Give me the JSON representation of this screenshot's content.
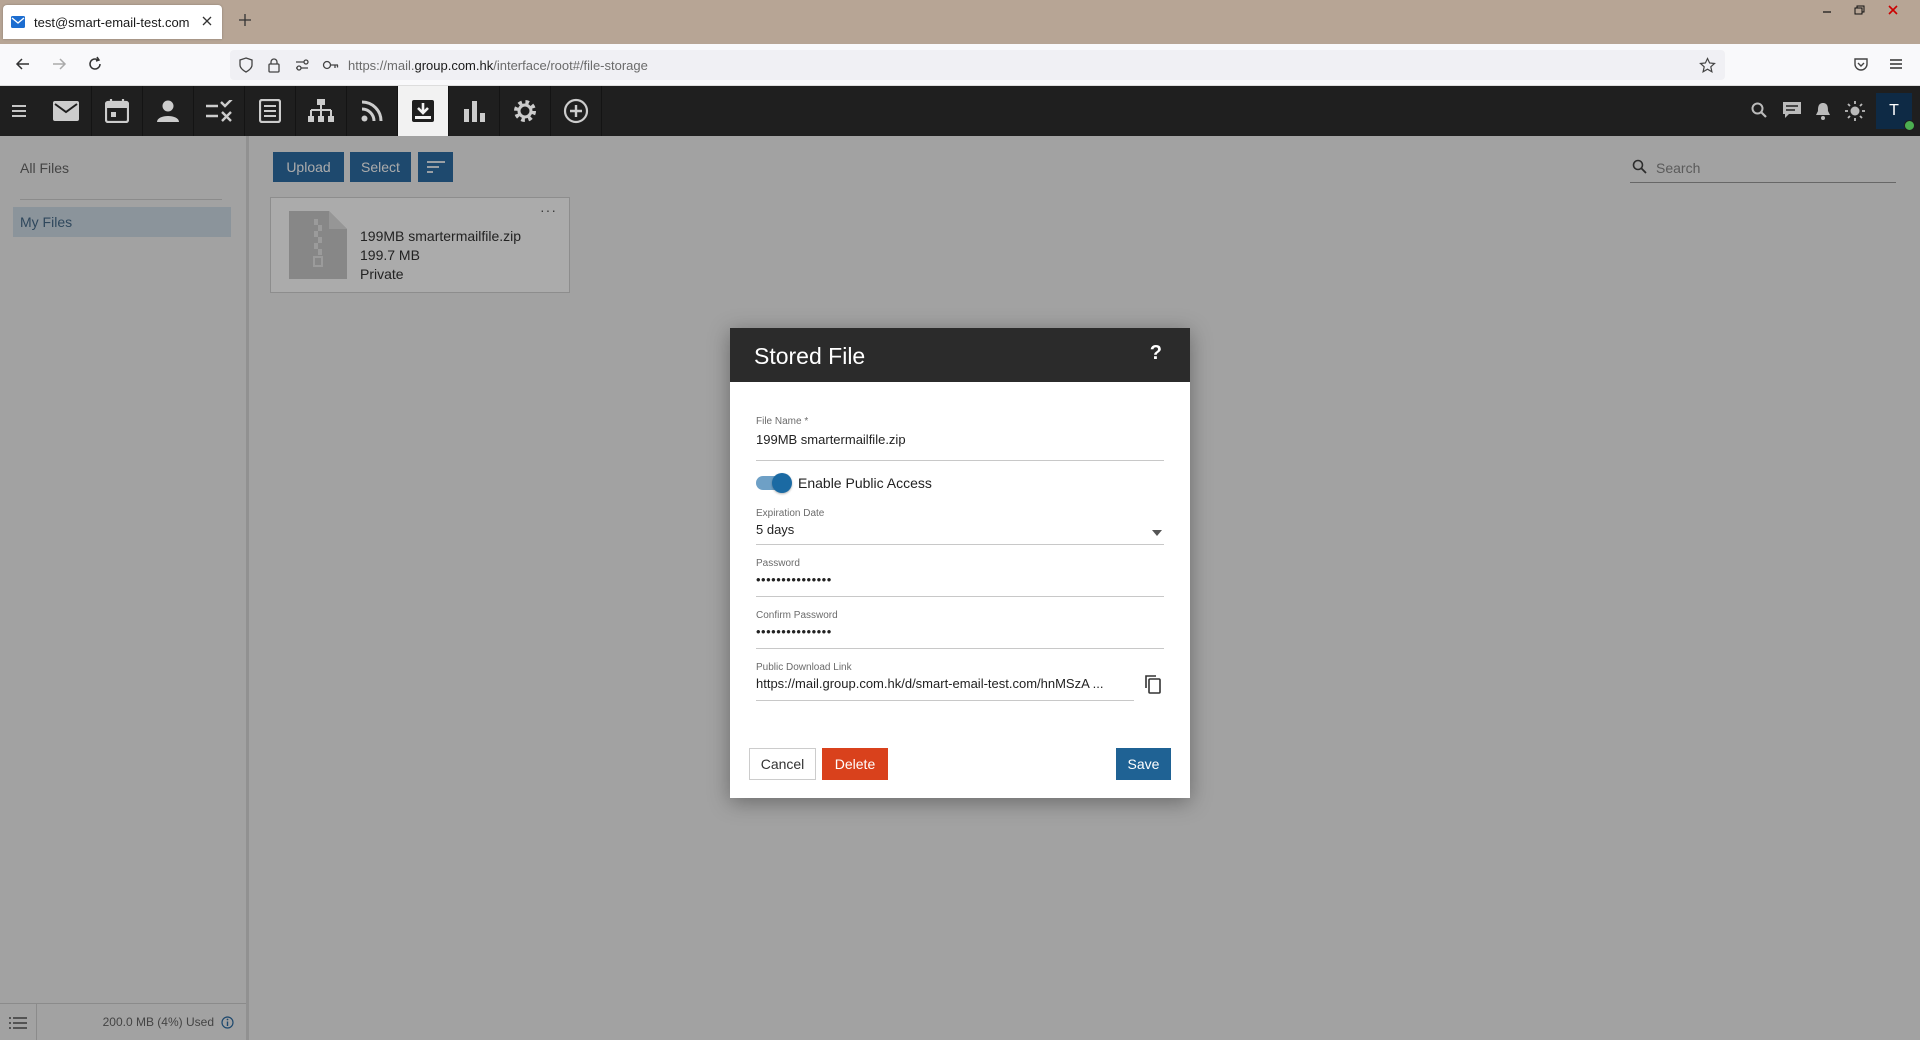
{
  "browser": {
    "tab_title": "test@smart-email-test.com",
    "url_prefix": "https://mail.",
    "url_domain": "group.com.hk",
    "url_path": "/interface/root#/file-storage"
  },
  "toolbar": {
    "icons": [
      "menu-icon",
      "mail-icon",
      "calendar-icon",
      "contacts-icon",
      "tasks-icon",
      "notes-icon",
      "sitemap-icon",
      "rss-icon",
      "file-storage-icon",
      "reports-icon",
      "settings-icon",
      "add-icon"
    ],
    "avatar_letter": "T",
    "avatar_color": "#0e2a45"
  },
  "sidebar": {
    "all_files": "All Files",
    "my_files": "My Files",
    "usage": "200.0 MB (4%) Used"
  },
  "content": {
    "upload_label": "Upload",
    "select_label": "Select",
    "search_placeholder": "Search",
    "file": {
      "name": "199MB smartermailfile.zip",
      "size": "199.7 MB",
      "access": "Private",
      "more": "···"
    }
  },
  "modal": {
    "title": "Stored File",
    "help": "?",
    "file_name_label": "File Name *",
    "file_name_value": "199MB smartermailfile.zip",
    "public_access_label": "Enable Public Access",
    "public_access_enabled": true,
    "expiration_label": "Expiration Date",
    "expiration_value": "5 days",
    "password_label": "Password",
    "password_value": "•••••••••••••••",
    "confirm_password_label": "Confirm Password",
    "confirm_password_value": "•••••••••••••••",
    "download_link_label": "Public Download Link",
    "download_link_value": "https://mail.group.com.hk/d/smart-email-test.com/hnMSzA ...",
    "cancel_label": "Cancel",
    "delete_label": "Delete",
    "save_label": "Save"
  },
  "colors": {
    "primary": "#2e6da4",
    "danger": "#d9411c",
    "save": "#1f6294",
    "toolbar": "#1f1f1f"
  }
}
